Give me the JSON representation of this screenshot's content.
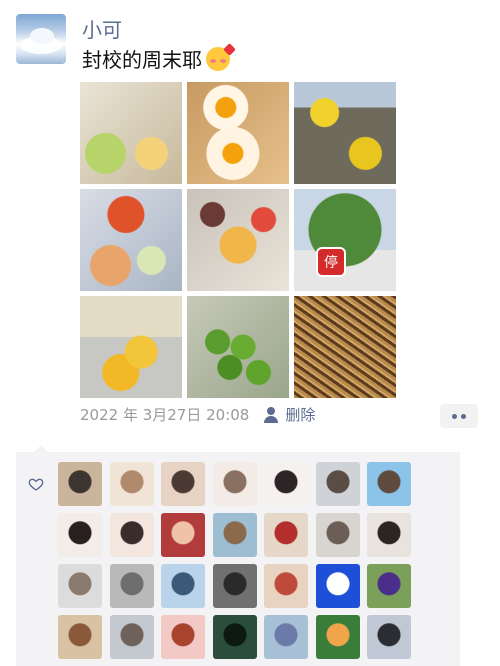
{
  "post": {
    "username": "小可",
    "text": "封校的周末耶",
    "emoji": "smiling-face-with-hearts",
    "timestamp": "2022 年 3月27日 20:08",
    "delete_label": "删除",
    "sign_text": "停",
    "photos": [
      "breakfast-eggs",
      "fried-eggs",
      "yellow-flower-tree-building",
      "fruit-salad-bowls",
      "dinner-dishes",
      "stop-sign-tree",
      "lemons",
      "green-limes",
      "fried-noodles"
    ]
  },
  "likes": {
    "icon": "heart-outline-icon",
    "avatars": [
      {
        "colors": [
          "#c9b59b",
          "#3d3530"
        ]
      },
      {
        "colors": [
          "#efe4d6",
          "#b08a6c"
        ]
      },
      {
        "colors": [
          "#e6d3c3",
          "#4b3a33"
        ]
      },
      {
        "colors": [
          "#f3ece6",
          "#8a7060"
        ]
      },
      {
        "colors": [
          "#f5f1ee",
          "#2c2426"
        ]
      },
      {
        "colors": [
          "#cfd3d8",
          "#5a4d45"
        ]
      },
      {
        "colors": [
          "#8cc3e8",
          "#5e4b3e"
        ]
      },
      {
        "colors": [
          "#f3ede8",
          "#2a2020"
        ]
      },
      {
        "colors": [
          "#f2e6df",
          "#3a2c2a"
        ]
      },
      {
        "colors": [
          "#b23b3b",
          "#f0c2a8"
        ]
      },
      {
        "colors": [
          "#9dbed2",
          "#8a6a4a"
        ]
      },
      {
        "colors": [
          "#e6d8c8",
          "#b42e2e"
        ]
      },
      {
        "colors": [
          "#d8d4cf",
          "#6b5e56"
        ]
      },
      {
        "colors": [
          "#e9e3de",
          "#2d2522"
        ]
      },
      {
        "colors": [
          "#dcdcdc",
          "#8a7b70"
        ]
      },
      {
        "colors": [
          "#b9b9b9",
          "#6e6e6e"
        ]
      },
      {
        "colors": [
          "#b9d3ea",
          "#3b5a7a"
        ]
      },
      {
        "colors": [
          "#707070",
          "#2a2a2a"
        ]
      },
      {
        "colors": [
          "#e7d3c0",
          "#c04a3a"
        ]
      },
      {
        "colors": [
          "#1d4fd8",
          "#ffffff"
        ]
      },
      {
        "colors": [
          "#7ba05a",
          "#4a2e8a"
        ]
      },
      {
        "colors": [
          "#d9c2a3",
          "#8a5a3a"
        ]
      },
      {
        "colors": [
          "#c3c9cf",
          "#6f625a"
        ]
      },
      {
        "colors": [
          "#f2c9c4",
          "#a8432e"
        ]
      },
      {
        "colors": [
          "#2a4e3a",
          "#0c1a12"
        ]
      },
      {
        "colors": [
          "#a7c0d6",
          "#6b7aa8"
        ]
      },
      {
        "colors": [
          "#3a7d3a",
          "#f0a54a"
        ]
      },
      {
        "colors": [
          "#bfc8d4",
          "#2c2c33"
        ]
      }
    ]
  }
}
